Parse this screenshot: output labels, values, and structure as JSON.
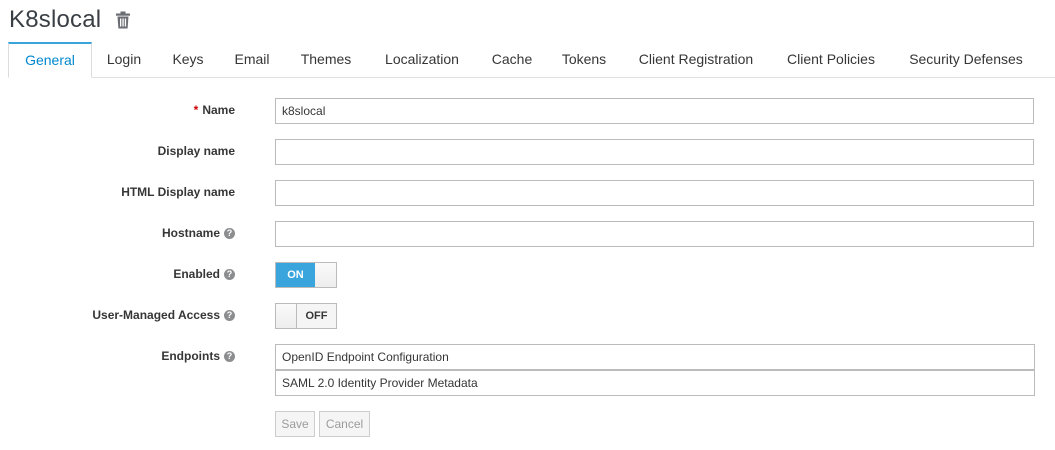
{
  "header": {
    "title": "K8slocal",
    "delete_icon": "trash-icon"
  },
  "tabs": [
    {
      "label": "General",
      "active": true
    },
    {
      "label": "Login"
    },
    {
      "label": "Keys"
    },
    {
      "label": "Email"
    },
    {
      "label": "Themes"
    },
    {
      "label": "Localization"
    },
    {
      "label": "Cache"
    },
    {
      "label": "Tokens"
    },
    {
      "label": "Client Registration"
    },
    {
      "label": "Client Policies"
    },
    {
      "label": "Security Defenses"
    }
  ],
  "form": {
    "name": {
      "required_mark": "*",
      "label": "Name",
      "value": "k8slocal"
    },
    "display_name": {
      "label": "Display name",
      "value": ""
    },
    "html_display_name": {
      "label": "HTML Display name",
      "value": ""
    },
    "hostname": {
      "label": "Hostname",
      "value": "",
      "help": "?"
    },
    "enabled": {
      "label": "Enabled",
      "help": "?",
      "state": "ON"
    },
    "user_managed_access": {
      "label": "User-Managed Access",
      "help": "?",
      "state": "OFF"
    },
    "endpoints": {
      "label": "Endpoints",
      "help": "?",
      "items": [
        "OpenID Endpoint Configuration",
        "SAML 2.0 Identity Provider Metadata"
      ]
    },
    "save_label": "Save",
    "cancel_label": "Cancel"
  },
  "colors": {
    "accent": "#39a5dc",
    "link": "#0088ce",
    "required": "#cc0000"
  }
}
